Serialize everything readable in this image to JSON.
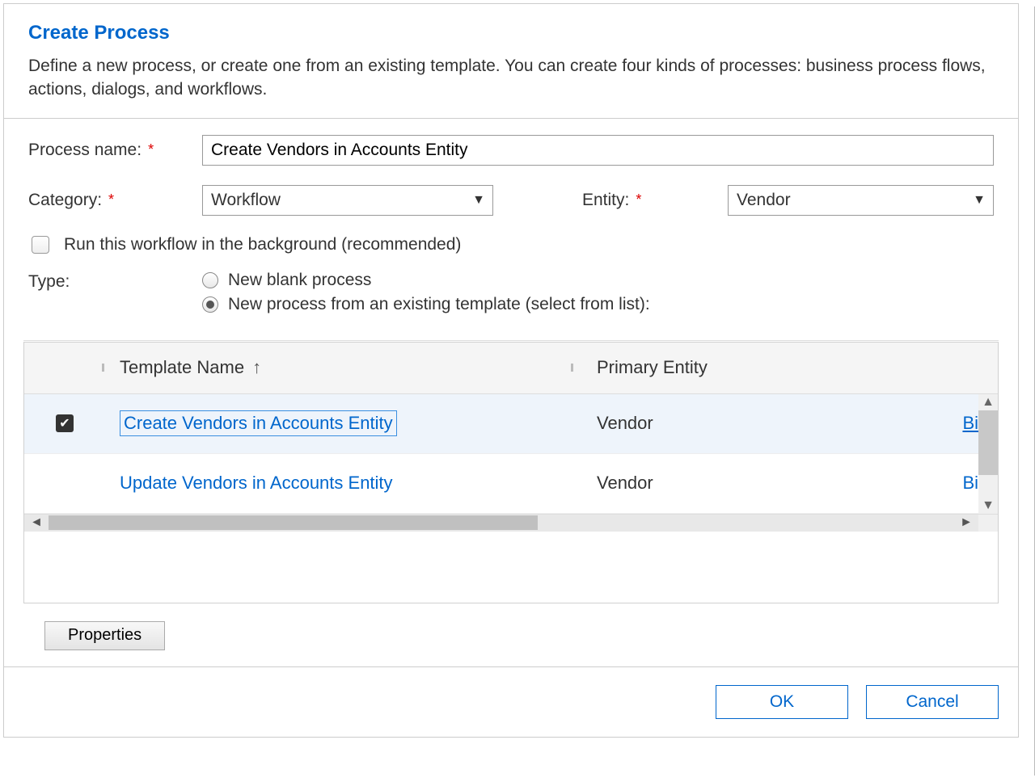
{
  "header": {
    "title": "Create Process",
    "description": "Define a new process, or create one from an existing template. You can create four kinds of processes: business process flows, actions, dialogs, and workflows."
  },
  "form": {
    "process_name_label": "Process name:",
    "process_name_value": "Create Vendors in Accounts Entity",
    "category_label": "Category:",
    "category_value": "Workflow",
    "entity_label": "Entity:",
    "entity_value": "Vendor",
    "background_label": "Run this workflow in the background (recommended)",
    "type_label": "Type:",
    "type_options": {
      "blank": "New blank process",
      "template": "New process from an existing template (select from list):"
    }
  },
  "grid": {
    "columns": {
      "template_name": "Template Name",
      "primary_entity": "Primary Entity"
    },
    "rows": [
      {
        "name": "Create Vendors in Accounts Entity",
        "entity": "Vendor",
        "extra": "Bi",
        "selected": true
      },
      {
        "name": "Update Vendors in Accounts Entity",
        "entity": "Vendor",
        "extra": "Bi",
        "selected": false
      }
    ]
  },
  "buttons": {
    "properties": "Properties",
    "ok": "OK",
    "cancel": "Cancel"
  }
}
